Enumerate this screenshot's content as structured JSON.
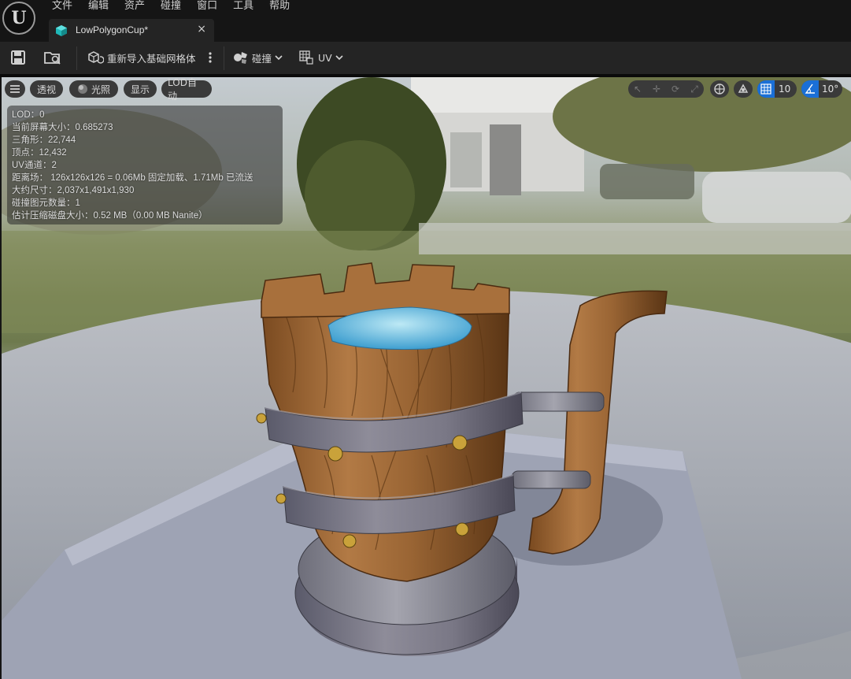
{
  "menu": [
    "文件",
    "编辑",
    "资产",
    "碰撞",
    "窗口",
    "工具",
    "帮助"
  ],
  "tab": {
    "title": "LowPolygonCup*",
    "close": "×"
  },
  "toolbar": {
    "reimport_label": "重新导入基础网格体",
    "collision_label": "碰撞",
    "uv_label": "UV"
  },
  "viewport_bar": {
    "perspective": "透视",
    "lit": "光照",
    "show": "显示",
    "lod": "LOD自动",
    "grid_size": "10",
    "angle_snap": "10°"
  },
  "stats": [
    "LOD：0",
    "当前屏幕大小：0.685273",
    "三角形：22,744",
    "顶点：12,432",
    "UV通道：2",
    "距离场：  126x126x126 = 0.06Mb 固定加载、1.71Mb 已流送",
    "大约尺寸：2,037x1,491x1,930",
    "碰撞图元数量：1",
    "估计压缩磁盘大小：0.52 MB（0.00 MB Nanite）"
  ],
  "colors": {
    "accent": "#1a6fd6",
    "tab_icon": "#26c6c6",
    "toolbar_bg": "#242424",
    "menubar_bg": "#151515"
  }
}
